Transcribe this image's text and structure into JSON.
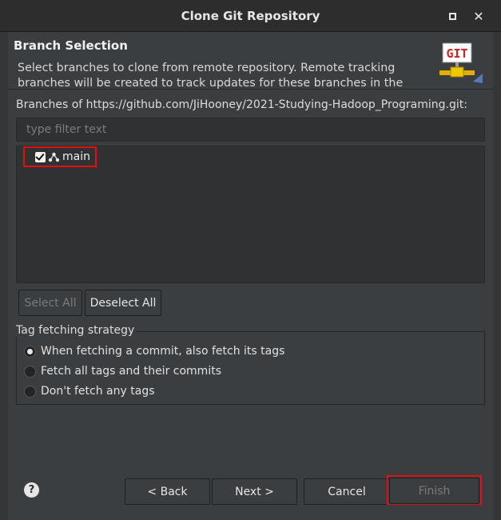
{
  "window": {
    "title": "Clone Git Repository",
    "maximize_icon": "square-icon",
    "close_icon": "close-icon",
    "close_glyph": "✕"
  },
  "header": {
    "title": "Branch Selection",
    "description": "Select branches to clone from remote repository. Remote tracking branches will be created to track updates for these branches in the remote repository.",
    "logo_text": "GIT"
  },
  "branches": {
    "label": "Branches of https://github.com/JiHooney/2021-Studying-Hadoop_Programing.git:",
    "filter_placeholder": "type filter text",
    "filter_value": "",
    "items": [
      {
        "label": "main",
        "checked": true,
        "icon": "branch-icon"
      }
    ]
  },
  "buttons": {
    "select_all": "Select All",
    "deselect_all": "Deselect All",
    "back": "< Back",
    "next": "Next >",
    "cancel": "Cancel",
    "finish": "Finish"
  },
  "tag_strategy": {
    "label": "Tag fetching strategy",
    "options": [
      {
        "label": "When fetching a commit, also fetch its tags",
        "selected": true
      },
      {
        "label": "Fetch all tags and their commits",
        "selected": false
      },
      {
        "label": "Don't fetch any tags",
        "selected": false
      }
    ]
  },
  "help": {
    "icon": "help-icon",
    "glyph": "?"
  },
  "colors": {
    "background": "#3b3e41",
    "titlebar": "#2d2d2d",
    "highlight": "#e01010",
    "text": "#dcdcdc"
  }
}
